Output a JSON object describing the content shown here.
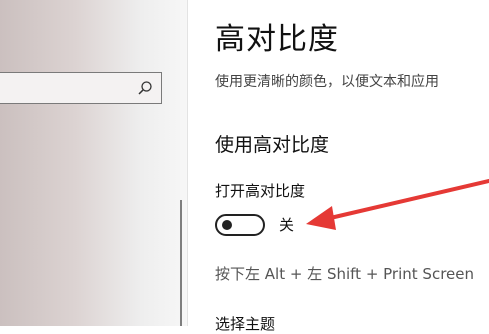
{
  "sidebar": {
    "search": {
      "placeholder": "",
      "icon": "search-icon"
    }
  },
  "main": {
    "title": "高对比度",
    "description": "使用更清晰的颜色，以便文本和应用",
    "section_heading": "使用高对比度",
    "toggle": {
      "label": "打开高对比度",
      "state": "关",
      "on": false
    },
    "shortcut_text": "按下左 Alt + 左 Shift + Print Screen",
    "choose_theme_label": "选择主题"
  },
  "annotation": {
    "arrow_color": "#e53935"
  }
}
